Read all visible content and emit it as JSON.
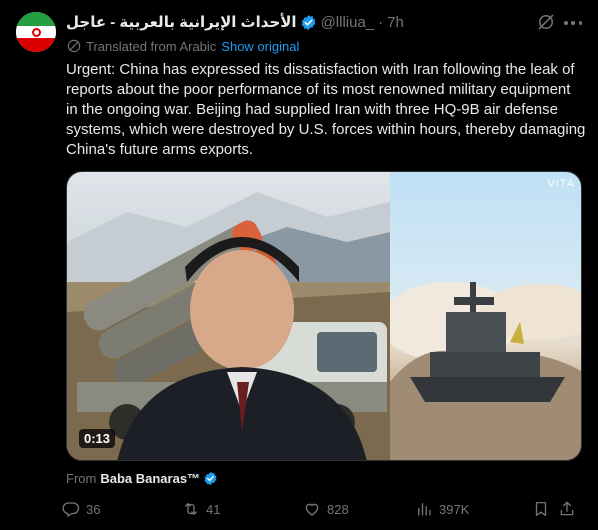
{
  "post": {
    "author_name": "الأحداث الإيرانية بالعربية - عاجل",
    "handle": "@llliua_",
    "separator": "·",
    "time": "7h",
    "translated_label": "Translated from Arabic",
    "show_original": "Show original",
    "text": "Urgent: China has expressed its dissatisfaction with Iran following the leak of reports about the poor performance of its most renowned military equipment in the ongoing war. Beijing had supplied Iran with three HQ-9B air defense systems, which were destroyed by U.S. forces within hours, thereby damaging China's future arms exports.",
    "media": {
      "duration": "0:13",
      "watermark": "VITA"
    },
    "from_label": "From",
    "from_name": "Baba Banaras™"
  },
  "actions": {
    "replies": "36",
    "reposts": "41",
    "likes": "828",
    "views": "397K"
  },
  "colors": {
    "background": "#000000",
    "text": "#e7e9ea",
    "muted": "#71767b",
    "link": "#1d9bf0",
    "verified": "#1d9bf0"
  },
  "icons": [
    "verified-badge-icon",
    "grok-icon",
    "more-icon",
    "translate-icon",
    "reply-icon",
    "repost-icon",
    "like-icon",
    "views-icon",
    "bookmark-icon",
    "share-icon"
  ]
}
